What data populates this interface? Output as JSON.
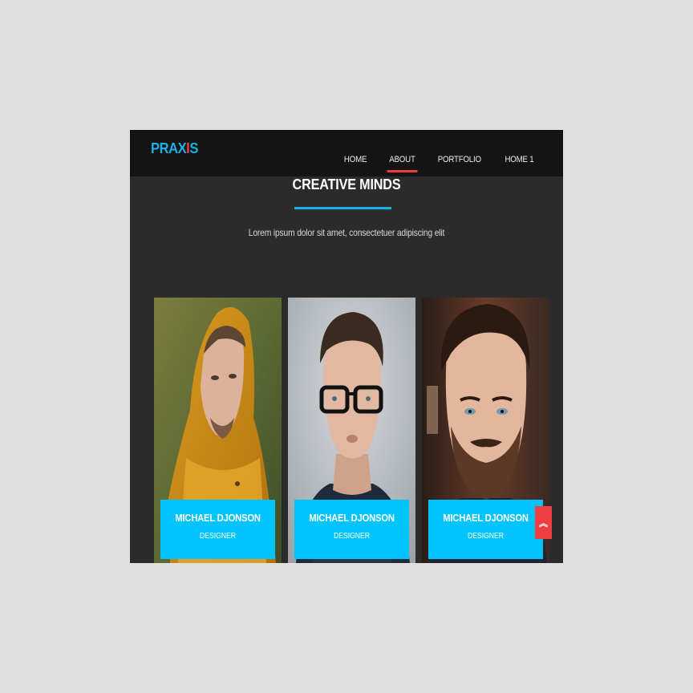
{
  "brand": {
    "logo_prefix": "PRAX",
    "logo_accent": "I",
    "logo_suffix": "S",
    "primary_color": "#1ab0e8",
    "accent_color": "#ef3e42"
  },
  "nav": {
    "items": [
      {
        "label": "HOME",
        "active": false
      },
      {
        "label": "ABOUT",
        "active": true
      },
      {
        "label": "PORTFOLIO",
        "active": false
      },
      {
        "label": "HOME 1",
        "active": false
      }
    ]
  },
  "section": {
    "title": "CREATIVE MINDS",
    "subtitle": "Lorem ipsum dolor sit amet, consectetuer adipiscing elit"
  },
  "team": {
    "members": [
      {
        "name": "MICHAEL DJONSON",
        "role": "DESIGNER",
        "photo": "man-yellow-hood-photo"
      },
      {
        "name": "MICHAEL DJONSON",
        "role": "DESIGNER",
        "photo": "man-glasses-photo"
      },
      {
        "name": "MICHAEL DJONSON",
        "role": "DESIGNER",
        "photo": "man-beard-photo"
      }
    ],
    "card_color": "#00c4fb"
  },
  "scroll_top": {
    "icon": "double-chevron-up-icon",
    "glyph": "︽"
  }
}
